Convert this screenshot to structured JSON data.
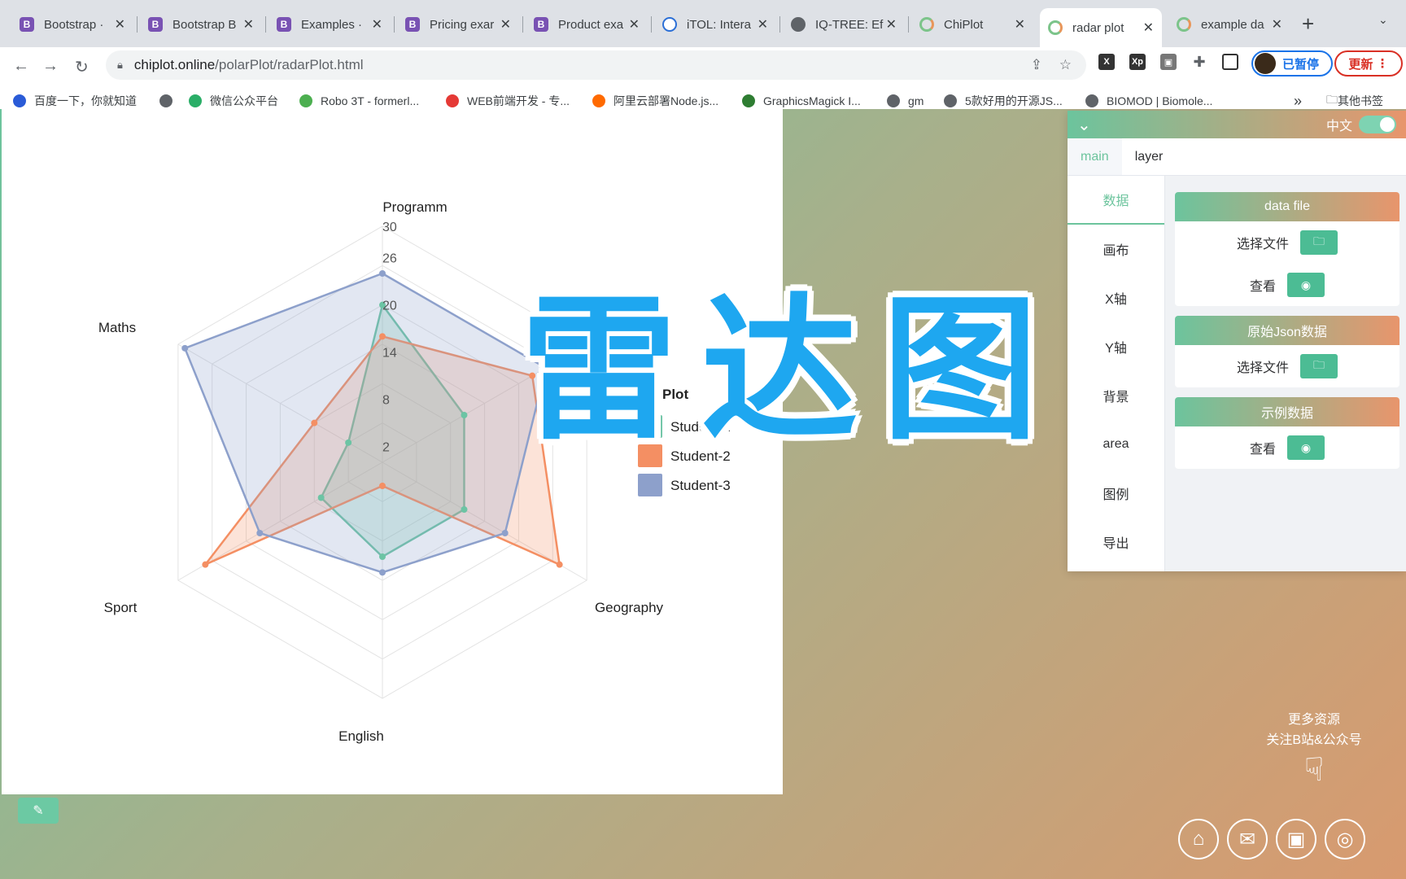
{
  "browser": {
    "tabs": [
      {
        "title": "Bootstrap ·",
        "icon": "bootstrap-icon"
      },
      {
        "title": "Bootstrap B",
        "icon": "bootstrap-icon"
      },
      {
        "title": "Examples ·",
        "icon": "bootstrap-icon"
      },
      {
        "title": "Pricing exar",
        "icon": "bootstrap-icon"
      },
      {
        "title": "Product exa",
        "icon": "bootstrap-icon"
      },
      {
        "title": "iTOL: Intera",
        "icon": "itol-icon"
      },
      {
        "title": "IQ-TREE: Ef",
        "icon": "globe-icon"
      },
      {
        "title": "ChiPlot",
        "icon": "chiplot-icon"
      },
      {
        "title": "radar plot",
        "icon": "chiplot-icon"
      },
      {
        "title": "example da",
        "icon": "chiplot-icon"
      }
    ],
    "active_tab": 8,
    "url_host": "chiplot.online",
    "url_path": "/polarPlot/radarPlot.html",
    "profile_label": "已暂停",
    "update_label": "更新",
    "bookmarks": [
      "百度一下，你就知道",
      "",
      "微信公众平台",
      "Robo 3T - formerl...",
      "WEB前端开发 - 专...",
      "阿里云部署Node.js...",
      "GraphicsMagick I...",
      "gm",
      "5款好用的开源JS...",
      "BIOMOD | Biomole..."
    ],
    "more_bookmarks": "»",
    "other_bookmarks": "其他书签"
  },
  "overlay_title": "雷达图",
  "settings": {
    "lang_label": "中文",
    "tabs": [
      "main",
      "layer"
    ],
    "menu": [
      "数据",
      "画布",
      "X轴",
      "Y轴",
      "背景",
      "area",
      "图例",
      "导出"
    ],
    "cards": [
      {
        "title": "data file",
        "rows": [
          "选择文件",
          "查看"
        ]
      },
      {
        "title": "原始Json数据",
        "rows": [
          "选择文件"
        ]
      },
      {
        "title": "示例数据",
        "rows": [
          "查看"
        ]
      }
    ]
  },
  "promo": {
    "line1": "更多资源",
    "line2": "关注B站&公众号"
  },
  "colors": {
    "student1": "#6cc4a4",
    "student2": "#f48f63",
    "student3": "#8da0cb",
    "accent": "#6cc49d"
  },
  "chart_data": {
    "type": "radar",
    "axes": [
      "Programm",
      "",
      "Geography",
      "English",
      "Sport",
      "Maths"
    ],
    "ticks": [
      "2",
      "8",
      "14",
      "20",
      "26",
      "30"
    ],
    "range": [
      0,
      30
    ],
    "legend_title": "Plot",
    "legend_position": "right",
    "series": [
      {
        "name": "Student-1",
        "values": [
          20,
          12,
          12,
          12,
          9,
          5
        ]
      },
      {
        "name": "Student-2",
        "values": [
          16,
          22,
          26,
          3,
          26,
          10
        ]
      },
      {
        "name": "Student-3",
        "values": [
          24,
          24,
          18,
          14,
          18,
          29
        ]
      }
    ]
  }
}
